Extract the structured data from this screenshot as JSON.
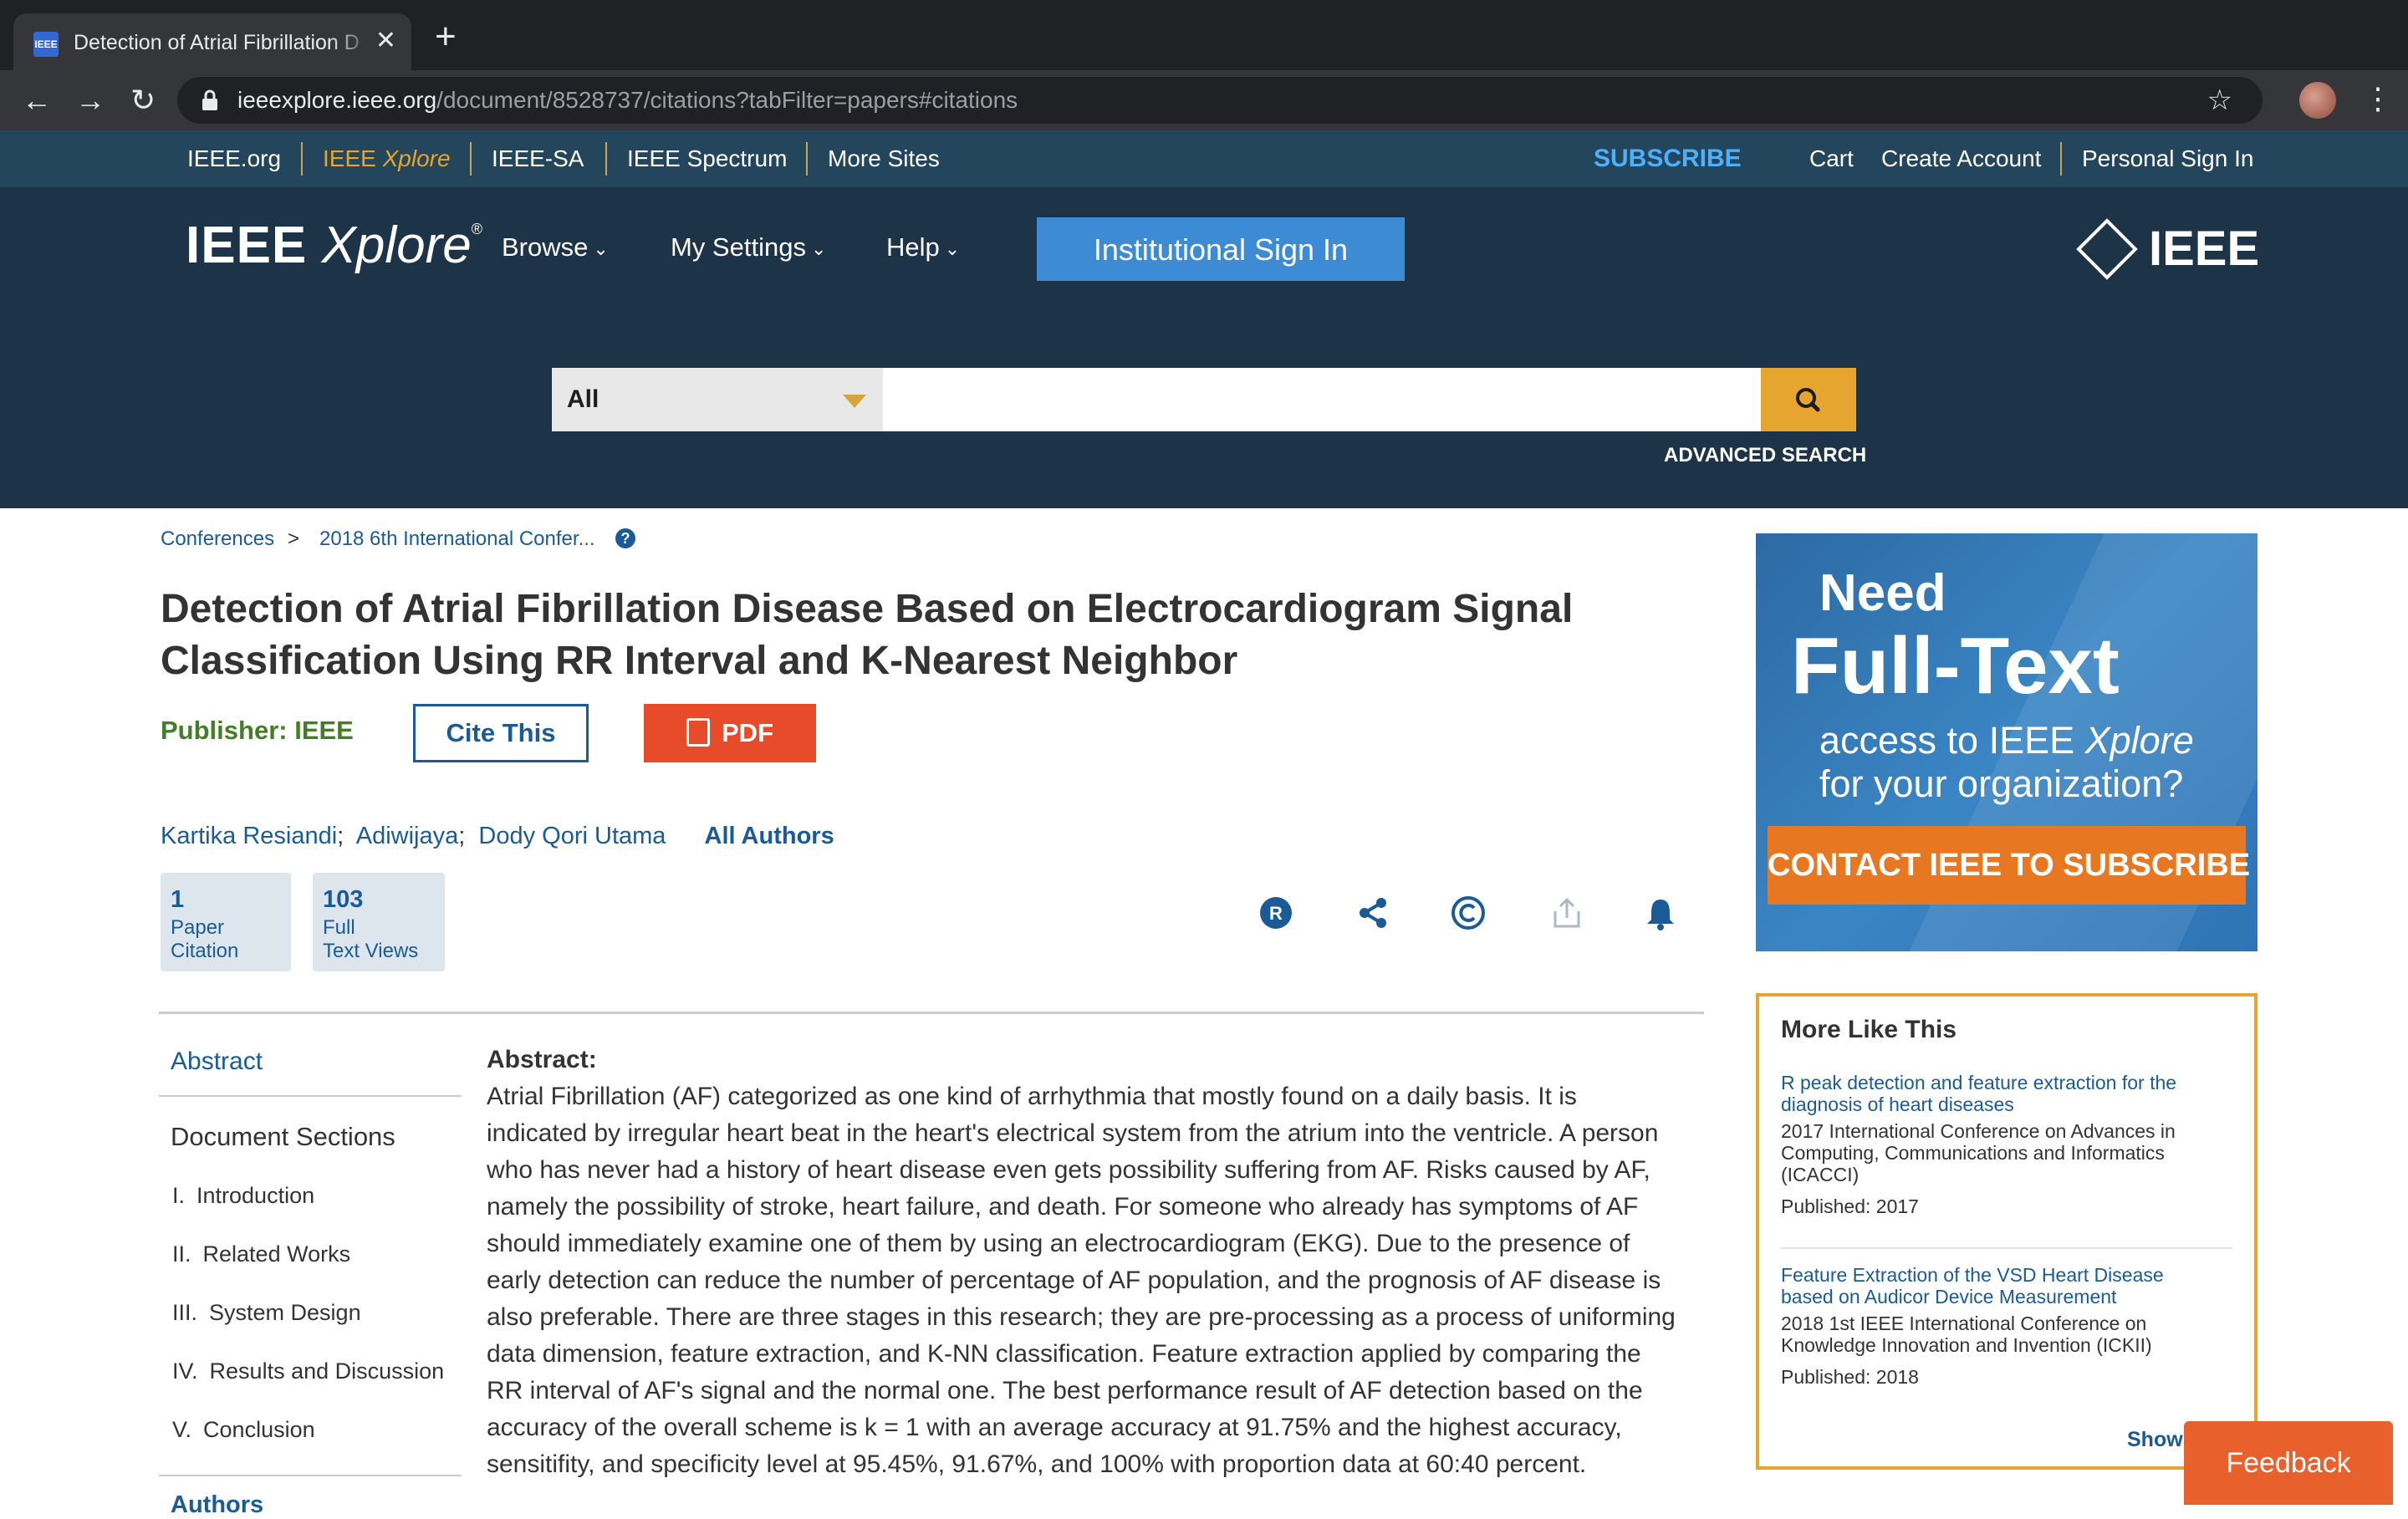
{
  "browser": {
    "tab_title": "Detection of Atrial Fibrillation D",
    "tab_favicon": "IEEE",
    "url_host": "ieeexplore.ieee.org",
    "url_path": "/document/8528737/citations?tabFilter=papers#citations"
  },
  "metabar": {
    "links": [
      "IEEE.org",
      "IEEE Xplore",
      "IEEE-SA",
      "IEEE Spectrum",
      "More Sites"
    ],
    "subscribe": "SUBSCRIBE",
    "cart": "Cart",
    "create_account": "Create Account",
    "sign_in": "Personal Sign In"
  },
  "header": {
    "logo_ieee": "IEEE",
    "logo_xplore": "Xplore",
    "nav": [
      "Browse",
      "My Settings",
      "Help"
    ],
    "institutional_sign_in": "Institutional Sign In",
    "ieee_logo": "IEEE",
    "search_scope": "All",
    "search_placeholder": "",
    "advanced_search": "ADVANCED SEARCH"
  },
  "breadcrumb": [
    "Conferences",
    "2018 6th International Confer..."
  ],
  "breadcrumb_separator": ">",
  "article": {
    "title": "Detection of Atrial Fibrillation Disease Based on Electrocardiogram Signal Classification Using RR Interval and K-Nearest Neighbor",
    "publisher_label": "Publisher:",
    "publisher": "IEEE",
    "cite_label": "Cite This",
    "pdf_label": "PDF",
    "authors": [
      "Kartika Resiandi",
      "Adiwijaya",
      "Dody Qori Utama"
    ],
    "author_separator": ";",
    "all_authors": "All Authors",
    "metrics": [
      {
        "value": "1",
        "line1": "Paper",
        "line2": "Citation"
      },
      {
        "value": "103",
        "line1": "Full",
        "line2": "Text Views"
      }
    ]
  },
  "left_nav": {
    "abstract": "Abstract",
    "sections_heading": "Document Sections",
    "sections": [
      {
        "num": "I.",
        "label": "Introduction"
      },
      {
        "num": "II.",
        "label": "Related Works"
      },
      {
        "num": "III.",
        "label": "System Design"
      },
      {
        "num": "IV.",
        "label": "Results and Discussion"
      },
      {
        "num": "V.",
        "label": "Conclusion"
      }
    ],
    "more": "Authors"
  },
  "abstract": {
    "heading": "Abstract:",
    "text": "Atrial Fibrillation (AF) categorized as one kind of arrhythmia that mostly found on a daily basis. It is indicated by irregular heart beat in the heart's electrical system from the atrium into the ventricle. A person who has never had a history of heart disease even gets possibility suffering from AF. Risks caused by AF, namely the possibility of stroke, heart failure, and death. For someone who already has symptoms of AF should immediately examine one of them by using an electrocardiogram (EKG). Due to the presence of early detection can reduce the number of percentage of AF population, and the prognosis of AF disease is also preferable. There are three stages in this research; they are pre-processing as a process of uniforming data dimension, feature extraction, and K-NN classification. Feature extraction applied by comparing the RR interval of AF's signal and the normal one. The best performance result of AF detection based on the accuracy of the overall scheme is k = 1 with an average accuracy at 91.75% and the highest accuracy, sensitifity, and specificity level at 95.45%, 91.67%, and 100% with proportion data at 60:40 percent."
  },
  "ad": {
    "line1": "Need",
    "line2": "Full-Text",
    "line3a": "access to IEEE ",
    "line3b": "Xplore",
    "line4": "for your organization?",
    "cta": "CONTACT IEEE TO SUBSCRIBE ›"
  },
  "more_like_this": {
    "heading": "More Like This",
    "items": [
      {
        "title": "R peak detection and feature extraction for the diagnosis of heart diseases",
        "venue": "2017 International Conference on Advances in Computing, Communications and Informatics (ICACCI)",
        "published": "Published: 2017"
      },
      {
        "title": "Feature Extraction of the VSD Heart Disease based on Audicor Device Measurement",
        "venue": "2018 1st IEEE International Conference on Knowledge Innovation and Invention (ICKII)",
        "published": "Published: 2018"
      }
    ],
    "show_more": "Show"
  },
  "feedback": "Feedback",
  "colors": {
    "header_dark": "#1d3347",
    "metabar": "#23465d",
    "accent_blue": "#3d8bd4",
    "link_blue": "#1a5b97",
    "pdf_red": "#e84b29",
    "search_gold": "#e5a52f",
    "publisher_green": "#437e27"
  },
  "icons": [
    "back-arrow-icon",
    "forward-arrow-icon",
    "reload-icon",
    "lock-icon",
    "star-icon",
    "search-icon",
    "pdf-icon",
    "rights-icon",
    "share-icon",
    "copyright-icon",
    "export-icon",
    "alert-bell-icon"
  ]
}
